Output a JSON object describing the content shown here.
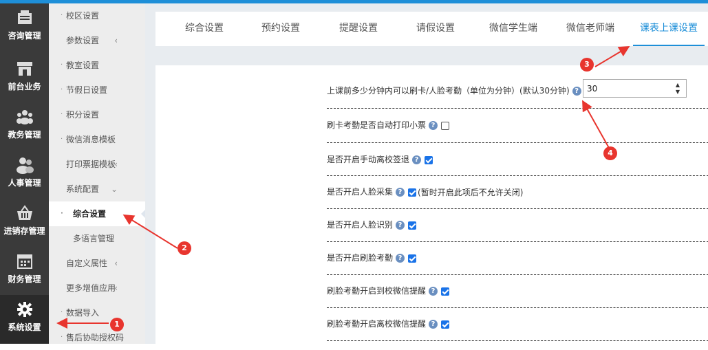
{
  "icon_nav": [
    {
      "label": "咨询管理",
      "icon": "consult-icon"
    },
    {
      "label": "前台业务",
      "icon": "store-icon"
    },
    {
      "label": "教务管理",
      "icon": "group-icon"
    },
    {
      "label": "人事管理",
      "icon": "people-icon"
    },
    {
      "label": "进销存管理",
      "icon": "basket-icon"
    },
    {
      "label": "财务管理",
      "icon": "calendar-icon"
    },
    {
      "label": "系统设置",
      "icon": "gear-icon"
    }
  ],
  "submenu": [
    {
      "label": "校区设置",
      "chevron": ""
    },
    {
      "label": "参数设置",
      "chevron": "‹"
    },
    {
      "label": "教室设置",
      "chevron": ""
    },
    {
      "label": "节假日设置",
      "chevron": ""
    },
    {
      "label": "积分设置",
      "chevron": ""
    },
    {
      "label": "微信消息模板",
      "chevron": ""
    },
    {
      "label": "打印票据模板",
      "chevron": "‹"
    },
    {
      "label": "系统配置",
      "chevron": "⌄"
    },
    {
      "label": "综合设置",
      "chevron": ""
    },
    {
      "label": "多语言管理",
      "chevron": ""
    },
    {
      "label": "自定义属性",
      "chevron": "‹"
    },
    {
      "label": "更多增值应用",
      "chevron": "‹"
    },
    {
      "label": "数据导入",
      "chevron": ""
    },
    {
      "label": "售后协助授权码",
      "chevron": ""
    }
  ],
  "tabs": [
    "综合设置",
    "预约设置",
    "提醒设置",
    "请假设置",
    "微信学生端",
    "微信老师端",
    "课表上课设置"
  ],
  "active_tab": "课表上课设置",
  "settings": {
    "r1_label": "上课前多少分钟内可以刷卡/人脸考勤（单位为分钟）(默认30分钟)",
    "r1_value": "30",
    "r2_label": "刷卡考勤是否自动打印小票",
    "r3_label": "是否开启手动离校签退",
    "r4_label": "是否开启人脸采集",
    "r4_note": "(暂时开启此项后不允许关闭)",
    "r5_label": "是否开启人脸识别",
    "r6_label": "是否开启刷脸考勤",
    "r7_label": "刷脸考勤开启到校微信提醒",
    "r8_label": "刷脸考勤开启离校微信提醒",
    "help_glyph": "?"
  },
  "checkbox_states": {
    "r2": false,
    "r3": true,
    "r4": true,
    "r5": true,
    "r6": true,
    "r7": true,
    "r8": true
  },
  "annotations": [
    "1",
    "2",
    "3",
    "4"
  ],
  "colors": {
    "accent": "#1e8fd8",
    "annotation": "#e8352e",
    "sidebar": "#3a3a3a"
  }
}
